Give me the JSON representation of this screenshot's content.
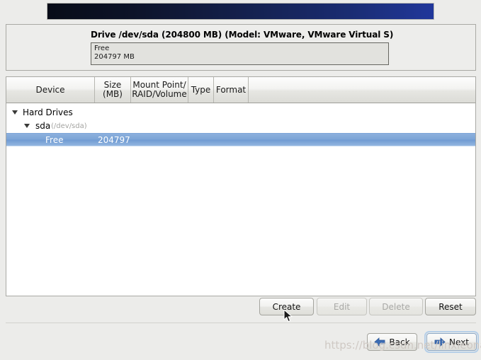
{
  "banner": {
    "name": "installer-banner"
  },
  "drive": {
    "title": "Drive /dev/sda (204800 MB) (Model: VMware, VMware Virtual S)",
    "segment_label": "Free",
    "segment_size": "204797 MB"
  },
  "table": {
    "columns": [
      {
        "label": "Device"
      },
      {
        "label": "Size\n(MB)",
        "line1": "Size",
        "line2": "(MB)"
      },
      {
        "label": "Mount Point/\nRAID/Volume",
        "line1": "Mount Point/",
        "line2": "RAID/Volume"
      },
      {
        "label": "Type"
      },
      {
        "label": "Format"
      },
      {
        "label": ""
      }
    ],
    "rows": [
      {
        "label": "Hard Drives",
        "sub": "",
        "size": "",
        "indent": 0,
        "expander": true,
        "selected": false
      },
      {
        "label": "sda",
        "sub": "(/dev/sda)",
        "size": "",
        "indent": 1,
        "expander": true,
        "selected": false
      },
      {
        "label": "Free",
        "sub": "",
        "size": "204797",
        "indent": 2,
        "expander": false,
        "selected": true
      }
    ]
  },
  "actions": {
    "create": "Create",
    "edit": "Edit",
    "delete": "Delete",
    "reset": "Reset"
  },
  "nav": {
    "back": "Back",
    "next": "Next"
  },
  "watermark": {
    "text": "https://blog.csdn.net/linxleona"
  },
  "colors": {
    "selection_blue": "#7ba4d6",
    "banner_dark": "#080c18",
    "banner_blue": "#21379b",
    "arrow_blue": "#3b6cb4"
  }
}
